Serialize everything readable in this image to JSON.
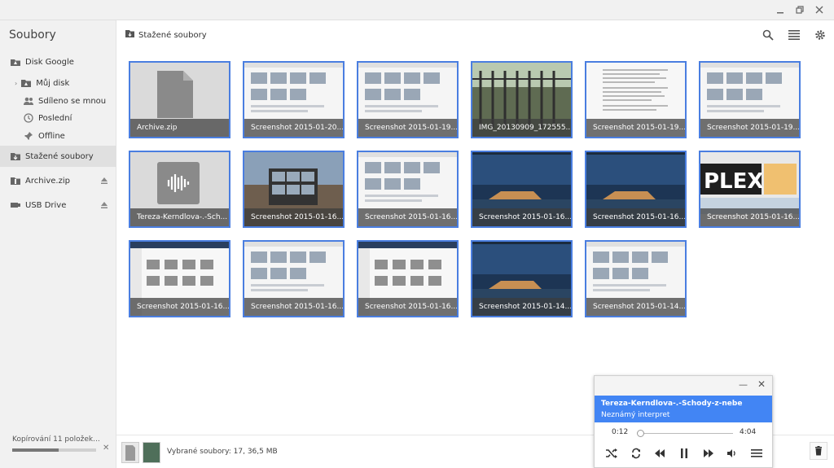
{
  "window": {
    "controls": [
      "minimize",
      "maximize",
      "close"
    ]
  },
  "sidebar": {
    "title": "Soubory",
    "items": [
      {
        "label": "Disk Google",
        "icon": "drive-icon"
      },
      {
        "label": "Můj disk",
        "icon": "folder-drive-icon"
      },
      {
        "label": "Sdíleno se mnou",
        "icon": "people-icon"
      },
      {
        "label": "Poslední",
        "icon": "clock-icon"
      },
      {
        "label": "Offline",
        "icon": "pin-icon"
      },
      {
        "label": "Stažené soubory",
        "icon": "download-folder-icon",
        "active": true
      },
      {
        "label": "Archive.zip",
        "icon": "archive-icon",
        "ejectable": true
      },
      {
        "label": "USB Drive",
        "icon": "usb-icon",
        "ejectable": true
      }
    ],
    "copy_status": "Kopírování 11 položek...",
    "copy_progress": 0.55
  },
  "toolbar": {
    "breadcrumb": "Stažené soubory"
  },
  "files": [
    {
      "name": "Archive.zip",
      "kind": "archive"
    },
    {
      "name": "Screenshot 2015-01-20...",
      "kind": "screenshot"
    },
    {
      "name": "Screenshot 2015-01-19...",
      "kind": "screenshot"
    },
    {
      "name": "IMG_20130909_172555...",
      "kind": "photo"
    },
    {
      "name": "Screenshot 2015-01-19...",
      "kind": "document"
    },
    {
      "name": "Screenshot 2015-01-19...",
      "kind": "screenshot"
    },
    {
      "name": "Tereza-Kerndlova-.-Sch...",
      "kind": "audio"
    },
    {
      "name": "Screenshot 2015-01-16...",
      "kind": "city"
    },
    {
      "name": "Screenshot 2015-01-16...",
      "kind": "screenshot"
    },
    {
      "name": "Screenshot 2015-01-16...",
      "kind": "landscape"
    },
    {
      "name": "Screenshot 2015-01-16...",
      "kind": "landscape"
    },
    {
      "name": "Screenshot 2015-01-16...",
      "kind": "plex"
    },
    {
      "name": "Screenshot 2015-01-16...",
      "kind": "desktop"
    },
    {
      "name": "Screenshot 2015-01-16...",
      "kind": "screenshot"
    },
    {
      "name": "Screenshot 2015-01-16...",
      "kind": "desktop"
    },
    {
      "name": "Screenshot 2015-01-14...",
      "kind": "landscape"
    },
    {
      "name": "Screenshot 2015-01-14...",
      "kind": "screenshot"
    }
  ],
  "footer": {
    "selected_text": "Vybrané soubory: 17, 36,5 MB"
  },
  "player": {
    "title": "Tereza-Kerndlova-.-Schody-z-nebe",
    "artist": "Neznámý interpret",
    "current_time": "0:12",
    "total_time": "4:04"
  },
  "colors": {
    "accent": "#4285f4",
    "selection_border": "#4a7ee0"
  }
}
